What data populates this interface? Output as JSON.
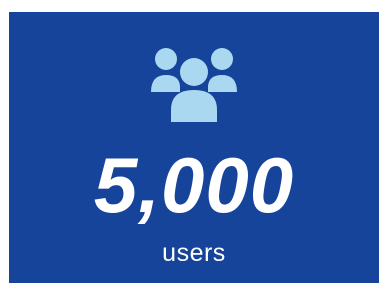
{
  "stat": {
    "icon": "users-group-icon",
    "value": "5,000",
    "label": "users"
  },
  "colors": {
    "background": "#16449a",
    "icon": "#a9d8f0",
    "text": "#ffffff"
  }
}
